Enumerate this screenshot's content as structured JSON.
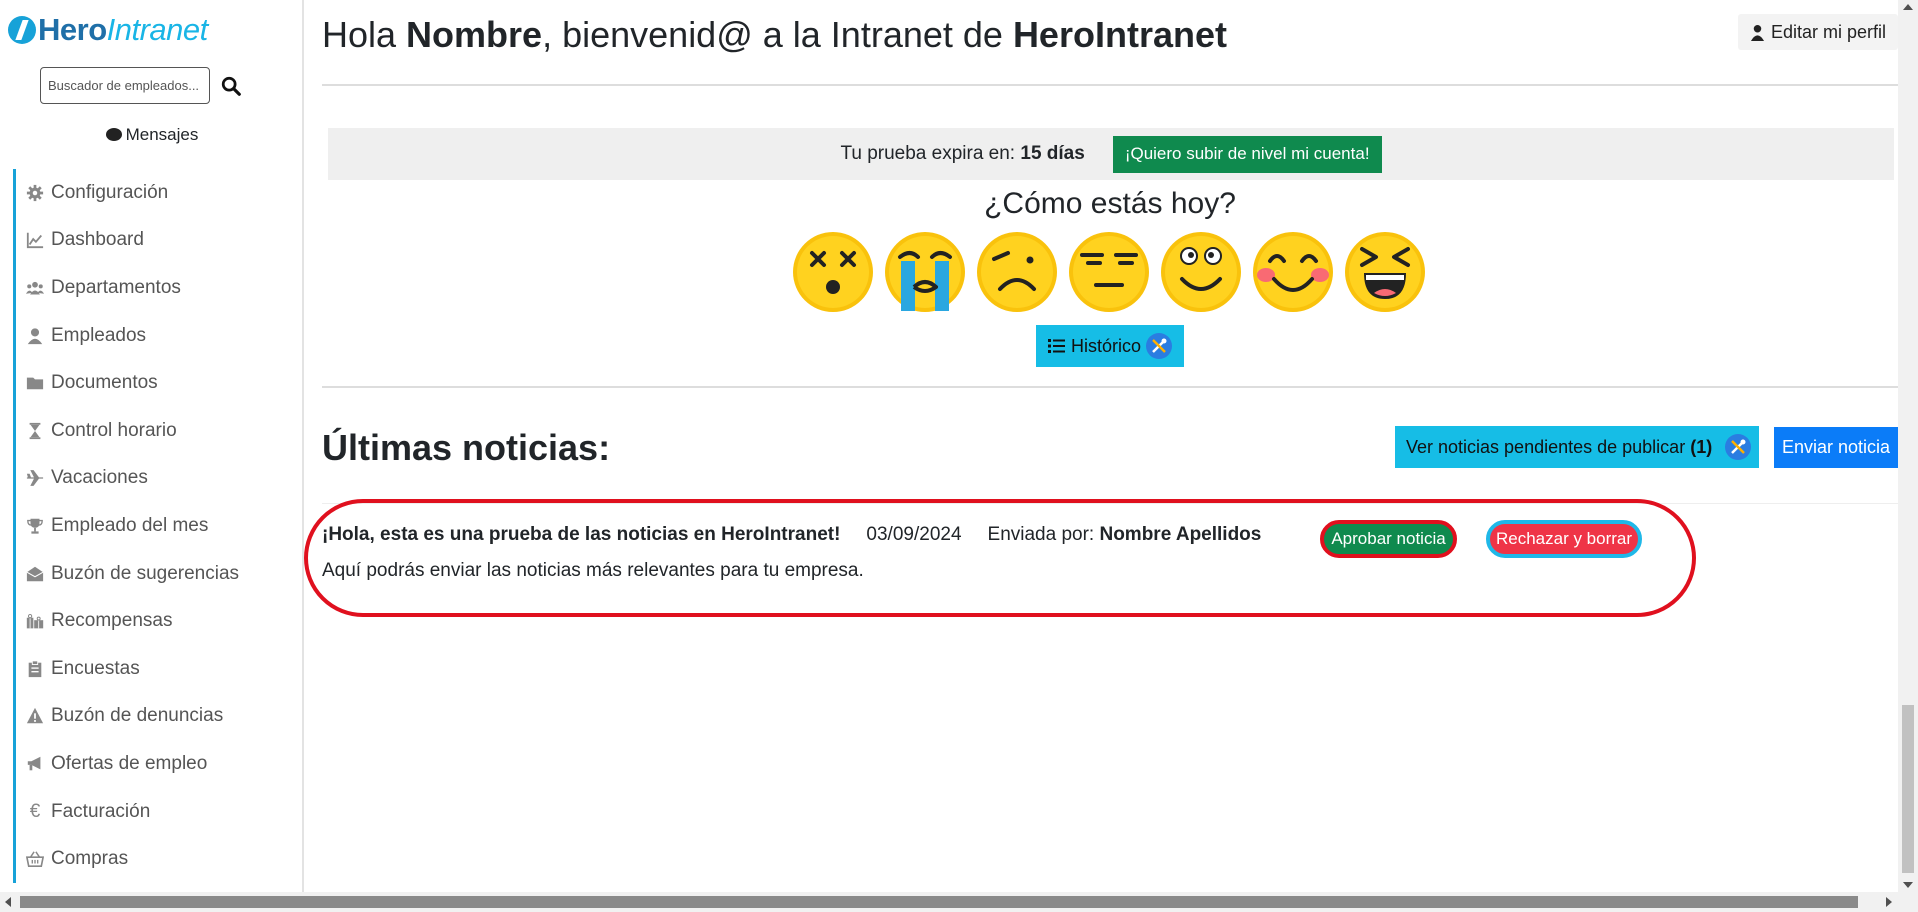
{
  "brand": {
    "hero": "Hero",
    "intranet": "Intranet"
  },
  "sidebar": {
    "search_placeholder": "Buscador de empleados...",
    "messages_label": "Mensajes",
    "items": [
      {
        "label": "Configuración",
        "icon": "gear-icon"
      },
      {
        "label": "Dashboard",
        "icon": "chart-line-icon"
      },
      {
        "label": "Departamentos",
        "icon": "users-icon"
      },
      {
        "label": "Empleados",
        "icon": "user-icon"
      },
      {
        "label": "Documentos",
        "icon": "folder-icon"
      },
      {
        "label": "Control horario",
        "icon": "hourglass-icon"
      },
      {
        "label": "Vacaciones",
        "icon": "plane-icon"
      },
      {
        "label": "Empleado del mes",
        "icon": "trophy-icon"
      },
      {
        "label": "Buzón de sugerencias",
        "icon": "mailbox-icon"
      },
      {
        "label": "Recompensas",
        "icon": "gifts-icon"
      },
      {
        "label": "Encuestas",
        "icon": "clipboard-icon"
      },
      {
        "label": "Buzón de denuncias",
        "icon": "warning-icon"
      },
      {
        "label": "Ofertas de empleo",
        "icon": "megaphone-icon"
      },
      {
        "label": "Facturación",
        "icon": "euro-icon"
      },
      {
        "label": "Compras",
        "icon": "basket-icon"
      }
    ]
  },
  "header": {
    "greeting_prefix": "Hola ",
    "user_name": "Nombre",
    "greeting_middle": ", bienvenid@ a la Intranet de ",
    "company": "HeroIntranet",
    "edit_profile_label": "Editar mi perfil"
  },
  "trial": {
    "text": "Tu prueba expira en: ",
    "days": "15 días",
    "upgrade_label": "¡Quiero subir de nivel mi cuenta!"
  },
  "mood": {
    "title": "¿Cómo estás hoy?",
    "options": [
      "dizzy-face",
      "crying-face",
      "sad-face",
      "neutral-face",
      "smiling-face",
      "blushing-face",
      "laughing-face"
    ],
    "history_label": "Histórico"
  },
  "news": {
    "title": "Últimas noticias:",
    "pending_label": "Ver noticias pendientes de publicar ",
    "pending_count": "(1)",
    "send_label": "Enviar noticia",
    "items": [
      {
        "title": "¡Hola, esta es una prueba de las noticias en HeroIntranet!",
        "date": "03/09/2024",
        "sent_by_label": "Enviada por: ",
        "author": "Nombre Apellidos",
        "approve_label": "Aprobar noticia",
        "reject_label": "Rechazar y borrar",
        "body": "Aquí podrás enviar las noticias más relevantes para tu empresa."
      }
    ]
  },
  "colors": {
    "accent": "#17a2d8",
    "success": "#0f8a4e",
    "danger": "#ef3447",
    "info": "#16bde6",
    "primary": "#0b7cf8",
    "highlight": "#e0101e"
  }
}
